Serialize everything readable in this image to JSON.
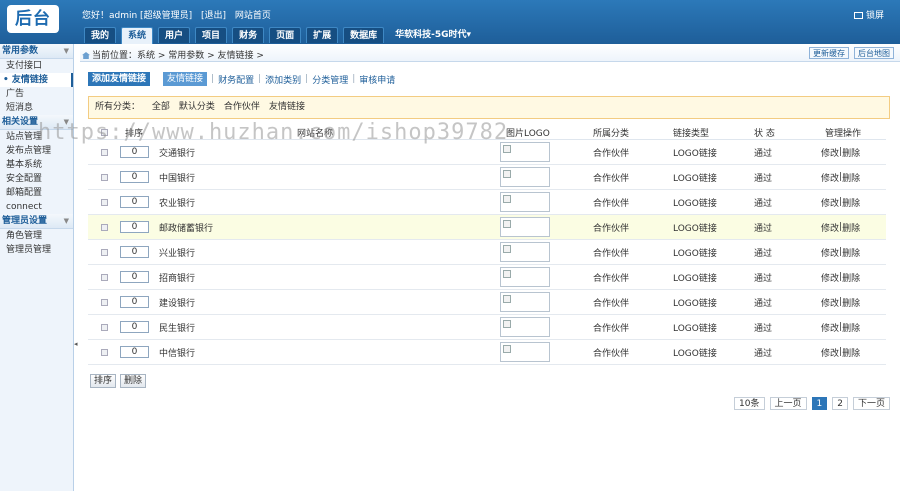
{
  "header": {
    "logo": "后台",
    "greeting": "您好！admin [超级管理员]",
    "logout": "[退出]",
    "site_home": "网站首页",
    "lock": "锁屏",
    "nav": [
      "我的",
      "系统",
      "用户",
      "项目",
      "财务",
      "页面",
      "扩展",
      "数据库"
    ],
    "nav_active": "系统",
    "brand": "华软科技-5G时代▾"
  },
  "sidebar": {
    "groups": [
      {
        "title": "常用参数",
        "items": [
          "支付接口",
          "友情链接",
          "广告",
          "短消息"
        ]
      },
      {
        "title": "相关设置",
        "items": [
          "站点管理",
          "发布点管理",
          "基本系统",
          "安全配置",
          "邮箱配置",
          "connect"
        ]
      },
      {
        "title": "管理员设置",
        "items": [
          "角色管理",
          "管理员管理"
        ]
      }
    ],
    "active_item": "友情链接"
  },
  "breadcrumb": "当前位置：系统 > 常用参数 > 友情链接 >",
  "top_actions": {
    "update_cache": "更新缓存",
    "site_map": "后台地图"
  },
  "subnav": {
    "add_button": "添加友情链接",
    "current": "友情链接",
    "links": [
      "财务配置",
      "添加类别",
      "分类管理",
      "审核申请"
    ]
  },
  "filter": {
    "label": "所有分类：",
    "options": [
      "全部",
      "默认分类",
      "合作伙伴",
      "友情链接"
    ]
  },
  "table": {
    "headers": {
      "order": "排序",
      "name": "网站名称",
      "logo": "图片LOGO",
      "category": "所属分类",
      "type": "链接类型",
      "status": "状 态",
      "ops": "管理操作"
    },
    "rows": [
      {
        "order": "0",
        "name": "交通银行",
        "category": "合作伙伴",
        "type": "LOGO链接",
        "status": "通过"
      },
      {
        "order": "0",
        "name": "中国银行",
        "category": "合作伙伴",
        "type": "LOGO链接",
        "status": "通过"
      },
      {
        "order": "0",
        "name": "农业银行",
        "category": "合作伙伴",
        "type": "LOGO链接",
        "status": "通过"
      },
      {
        "order": "0",
        "name": "邮政储蓄银行",
        "category": "合作伙伴",
        "type": "LOGO链接",
        "status": "通过"
      },
      {
        "order": "0",
        "name": "兴业银行",
        "category": "合作伙伴",
        "type": "LOGO链接",
        "status": "通过"
      },
      {
        "order": "0",
        "name": "招商银行",
        "category": "合作伙伴",
        "type": "LOGO链接",
        "status": "通过"
      },
      {
        "order": "0",
        "name": "建设银行",
        "category": "合作伙伴",
        "type": "LOGO链接",
        "status": "通过"
      },
      {
        "order": "0",
        "name": "民生银行",
        "category": "合作伙伴",
        "type": "LOGO链接",
        "status": "通过"
      },
      {
        "order": "0",
        "name": "中信银行",
        "category": "合作伙伴",
        "type": "LOGO链接",
        "status": "通过"
      }
    ],
    "highlighted_row": 3,
    "edit": "修改",
    "delete": "删除",
    "ops_sep": " | "
  },
  "bulk": {
    "sort": "排序",
    "delete": "删除"
  },
  "pager": {
    "count": "10条",
    "prev": "上一页",
    "pages": [
      "1",
      "2"
    ],
    "current": "1",
    "next": "下一页"
  },
  "watermark": "https://www.huzhan.com/ishop39782"
}
